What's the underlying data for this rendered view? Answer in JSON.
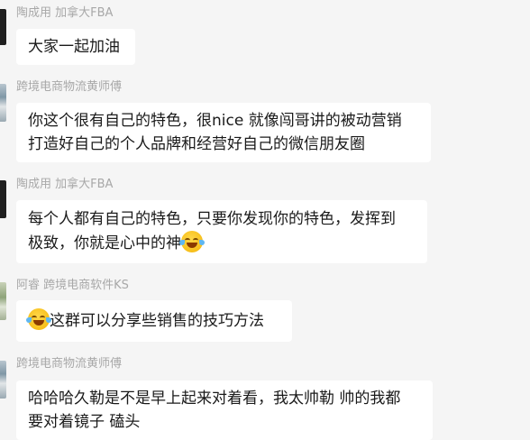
{
  "messages": [
    {
      "sender": "陶成用 加拿大FBA",
      "lines": [
        "大家一起加油"
      ]
    },
    {
      "sender": "跨境电商物流黄师傅",
      "lines": [
        "你这个很有自己的特色，很nice 就像闯哥讲的被动营销",
        " 打造好自己的个人品牌和经营好自己的微信朋友圈"
      ]
    },
    {
      "sender": "陶成用 加拿大FBA",
      "lines": [
        "每个人都有自己的特色，只要你发现你的特色，发挥到",
        "极致，你就是心中的神"
      ],
      "emoji_after_line": 1,
      "emoji": "laughing-crying-emoji"
    },
    {
      "sender": "阿睿 跨境电商软件KS",
      "lines": [
        "这群可以分享些销售的技巧方法"
      ],
      "emoji_before_line": 0,
      "emoji": "laughing-crying-emoji"
    },
    {
      "sender": "跨境电商物流黄师傅",
      "lines": [
        "哈哈哈久勒是不是早上起来对着看，我太帅勒 帅的我都",
        "要对着镜子 磕头"
      ]
    }
  ]
}
